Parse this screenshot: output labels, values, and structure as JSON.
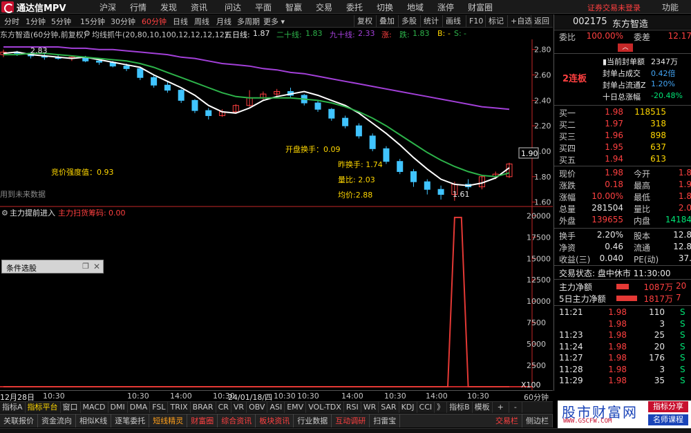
{
  "app": {
    "name": "通达信MPV",
    "security_warning": "证券交易未登录",
    "func_label": "功能"
  },
  "menu": [
    "沪深",
    "行情",
    "发现",
    "资讯",
    "问达",
    "平面",
    "智赢",
    "交易",
    "委托",
    "切换",
    "地域",
    "涨停",
    "财富圈"
  ],
  "periods": [
    {
      "label": "分时",
      "active": false
    },
    {
      "label": "1分钟",
      "active": false
    },
    {
      "label": "5分钟",
      "active": false
    },
    {
      "label": "15分钟",
      "active": false
    },
    {
      "label": "30分钟",
      "active": false
    },
    {
      "label": "60分钟",
      "active": true
    },
    {
      "label": "日线",
      "active": false
    },
    {
      "label": "周线",
      "active": false
    },
    {
      "label": "月线",
      "active": false
    },
    {
      "label": "多周期",
      "active": false
    },
    {
      "label": "更多",
      "active": false
    }
  ],
  "toolbar": [
    "复权",
    "叠加",
    "多股",
    "统计",
    "画线",
    "F10",
    "标记",
    "+自选",
    "返回"
  ],
  "indicator_line": {
    "stock": "东方智造(60分钟,前复权)",
    "indicator": "均线抓牛(20,80,10,100,12,12,12,12)",
    "ma5_label": "五日线:",
    "ma5_value": "1.87",
    "ma20_label": "二十线:",
    "ma20_value": "1.83",
    "ma90_label": "九十线:",
    "ma90_value": "2.33",
    "rise_label": "涨:",
    "rise_value": "",
    "fall_label": "跌:",
    "fall_value": "1.83",
    "b_label": "B:",
    "b_value": "-",
    "s_label": "S:",
    "s_value": "-"
  },
  "annotations": {
    "open_turnover": "开盘换手：0.09",
    "bid_strength": "竞价强度值：0.93",
    "prev_turnover": "昨换手: 1.74",
    "volume_ratio": "量比: 2.03",
    "avg_price": "均价:2.88",
    "hint": "用到未来数据",
    "low_mark": "1.61",
    "price_tag": "1.90",
    "high_mark_left": "2.83"
  },
  "sub_indicator": {
    "name": "主力提前进入",
    "line_label": "主力扫货筹码:",
    "line_value": "0.00"
  },
  "cond_panel": {
    "title": "条件选股"
  },
  "chart_data": [
    {
      "type": "line",
      "title": "",
      "y_ticks": [
        "2.80",
        "2.60",
        "2.40",
        "2.20",
        "2.00",
        "1.80",
        "1.60"
      ],
      "ylim": [
        1.56,
        2.88
      ],
      "x_labels": [
        "12月28日",
        "10:30",
        "10:30",
        "14:00",
        "10:30",
        "14:00",
        "10:30",
        "24/01/18/四",
        "10:30",
        "10:30",
        "14:00",
        "10:30",
        "14:00",
        "10:30"
      ],
      "series": [
        {
          "name": "五日线",
          "color": "#ffffff",
          "values": [
            2.77,
            2.78,
            2.76,
            2.75,
            2.74,
            2.73,
            2.74,
            2.72,
            2.7,
            2.68,
            2.66,
            2.6,
            2.55,
            2.5,
            2.44,
            2.36,
            2.31,
            2.3,
            2.34,
            2.4,
            2.43,
            2.45,
            2.47,
            2.44,
            2.4,
            2.36,
            2.3,
            2.22,
            2.14,
            2.05,
            1.95,
            1.86,
            1.78,
            1.74,
            1.73,
            1.75,
            1.79,
            1.87
          ]
        },
        {
          "name": "二十线",
          "color": "#2db34a",
          "values": [
            2.76,
            2.76,
            2.77,
            2.77,
            2.76,
            2.75,
            2.74,
            2.73,
            2.72,
            2.71,
            2.69,
            2.66,
            2.62,
            2.58,
            2.54,
            2.5,
            2.46,
            2.43,
            2.42,
            2.42,
            2.42,
            2.42,
            2.41,
            2.4,
            2.38,
            2.35,
            2.31,
            2.26,
            2.2,
            2.13,
            2.06,
            1.99,
            1.93,
            1.88,
            1.84,
            1.81,
            1.8,
            1.83
          ]
        },
        {
          "name": "九十线",
          "color": "#a340d9",
          "values": [
            2.82,
            2.82,
            2.82,
            2.82,
            2.82,
            2.81,
            2.81,
            2.8,
            2.8,
            2.79,
            2.78,
            2.77,
            2.76,
            2.74,
            2.73,
            2.71,
            2.69,
            2.68,
            2.67,
            2.65,
            2.64,
            2.62,
            2.61,
            2.59,
            2.57,
            2.55,
            2.53,
            2.51,
            2.49,
            2.47,
            2.45,
            2.43,
            2.41,
            2.39,
            2.37,
            2.35,
            2.34,
            2.33
          ]
        }
      ],
      "candles": [
        {
          "o": 2.76,
          "c": 2.78,
          "h": 2.8,
          "l": 2.74
        },
        {
          "o": 2.78,
          "c": 2.77,
          "h": 2.79,
          "l": 2.75
        },
        {
          "o": 2.77,
          "c": 2.75,
          "h": 2.78,
          "l": 2.73
        },
        {
          "o": 2.75,
          "c": 2.74,
          "h": 2.77,
          "l": 2.72
        },
        {
          "o": 2.74,
          "c": 2.73,
          "h": 2.76,
          "l": 2.72
        },
        {
          "o": 2.73,
          "c": 2.74,
          "h": 2.75,
          "l": 2.71
        },
        {
          "o": 2.74,
          "c": 2.71,
          "h": 2.75,
          "l": 2.7
        },
        {
          "o": 2.71,
          "c": 2.7,
          "h": 2.72,
          "l": 2.68
        },
        {
          "o": 2.7,
          "c": 2.67,
          "h": 2.71,
          "l": 2.66
        },
        {
          "o": 2.67,
          "c": 2.65,
          "h": 2.69,
          "l": 2.63
        },
        {
          "o": 2.65,
          "c": 2.58,
          "h": 2.66,
          "l": 2.56
        },
        {
          "o": 2.58,
          "c": 2.52,
          "h": 2.6,
          "l": 2.5
        },
        {
          "o": 2.52,
          "c": 2.48,
          "h": 2.55,
          "l": 2.46
        },
        {
          "o": 2.48,
          "c": 2.4,
          "h": 2.49,
          "l": 2.38
        },
        {
          "o": 2.4,
          "c": 2.32,
          "h": 2.41,
          "l": 2.3
        },
        {
          "o": 2.32,
          "c": 2.28,
          "h": 2.34,
          "l": 2.25
        },
        {
          "o": 2.28,
          "c": 2.31,
          "h": 2.33,
          "l": 2.27
        },
        {
          "o": 2.31,
          "c": 2.36,
          "h": 2.37,
          "l": 2.3
        },
        {
          "o": 2.36,
          "c": 2.42,
          "h": 2.48,
          "l": 2.35
        },
        {
          "o": 2.42,
          "c": 2.45,
          "h": 2.47,
          "l": 2.4
        },
        {
          "o": 2.45,
          "c": 2.47,
          "h": 2.49,
          "l": 2.43
        },
        {
          "o": 2.47,
          "c": 2.44,
          "h": 2.5,
          "l": 2.42
        },
        {
          "o": 2.44,
          "c": 2.38,
          "h": 2.45,
          "l": 2.36
        },
        {
          "o": 2.38,
          "c": 2.33,
          "h": 2.4,
          "l": 2.31
        },
        {
          "o": 2.33,
          "c": 2.26,
          "h": 2.34,
          "l": 2.24
        },
        {
          "o": 2.26,
          "c": 2.2,
          "h": 2.28,
          "l": 2.18
        },
        {
          "o": 2.2,
          "c": 2.12,
          "h": 2.22,
          "l": 2.1
        },
        {
          "o": 2.12,
          "c": 2.02,
          "h": 2.14,
          "l": 2.0
        },
        {
          "o": 2.02,
          "c": 1.92,
          "h": 2.04,
          "l": 1.9
        },
        {
          "o": 1.92,
          "c": 1.84,
          "h": 1.94,
          "l": 1.82
        },
        {
          "o": 1.84,
          "c": 1.76,
          "h": 1.86,
          "l": 1.72
        },
        {
          "o": 1.76,
          "c": 1.7,
          "h": 1.78,
          "l": 1.66
        },
        {
          "o": 1.7,
          "c": 1.66,
          "h": 1.73,
          "l": 1.62
        },
        {
          "o": 1.66,
          "c": 1.74,
          "h": 1.76,
          "l": 1.61
        },
        {
          "o": 1.74,
          "c": 1.72,
          "h": 1.78,
          "l": 1.7
        },
        {
          "o": 1.72,
          "c": 1.8,
          "h": 1.81,
          "l": 1.7
        },
        {
          "o": 1.8,
          "c": 1.82,
          "h": 1.84,
          "l": 1.78
        },
        {
          "o": 1.8,
          "c": 1.9,
          "h": 1.91,
          "l": 1.79
        }
      ]
    },
    {
      "type": "line",
      "title": "主力提前进入",
      "y_ticks": [
        "20000",
        "17500",
        "15000",
        "12500",
        "10000",
        "7500",
        "5000",
        "2500"
      ],
      "ylim": [
        0,
        21000
      ],
      "y_unit": "X100",
      "series": [
        {
          "name": "主力扫货筹码",
          "color": "#e53935",
          "values": [
            0,
            0,
            0,
            0,
            0,
            0,
            0,
            0,
            0,
            0,
            0,
            0,
            0,
            0,
            0,
            0,
            0,
            0,
            0,
            0,
            0,
            0,
            0,
            0,
            0,
            0,
            0,
            0,
            0,
            0,
            0,
            0,
            0,
            19800,
            0,
            0,
            0,
            0
          ]
        }
      ]
    }
  ],
  "time_axis": {
    "labels": [
      "12月28日",
      "10:30",
      "10:30",
      "14:00",
      "10:30",
      "24/01/18/四",
      "10:30",
      "10:30",
      "14:00",
      "10:30",
      "14:00",
      "10:30"
    ],
    "right_label": "60分钟"
  },
  "indicator_tabs": [
    "指标A",
    "指标平台",
    "窗口",
    "MACD",
    "DMI",
    "DMA",
    "FSL",
    "TRIX",
    "BRAR",
    "CR",
    "VR",
    "OBV",
    "ASI",
    "EMV",
    "VOL-TDX",
    "RSI",
    "WR",
    "SAR",
    "KDJ",
    "CCI",
    "》",
    "指标B",
    "模板"
  ],
  "indicator_tabs_right": [
    "+",
    "-"
  ],
  "bottom_bar": [
    {
      "label": "关联报价",
      "style": ""
    },
    {
      "label": "资金流向",
      "style": ""
    },
    {
      "label": "相似K线",
      "style": ""
    },
    {
      "label": "逐笔委托",
      "style": ""
    },
    {
      "label": "短线精灵",
      "style": "orange"
    },
    {
      "label": "财富圈",
      "style": "red"
    },
    {
      "label": "综合资讯",
      "style": "red"
    },
    {
      "label": "板块资讯",
      "style": "red"
    },
    {
      "label": "行业数据",
      "style": ""
    },
    {
      "label": "互动调研",
      "style": "red"
    },
    {
      "label": "扫雷宝",
      "style": ""
    },
    {
      "label": "交易栏",
      "style": "red"
    },
    {
      "label": "侧边栏",
      "style": ""
    }
  ],
  "quote": {
    "code": "002175",
    "name": "东方智造",
    "weibi_label": "委比",
    "weibi": "100.00%",
    "weicha_label": "委差",
    "weicha": "12.17",
    "limit_badge": "2连板",
    "seal_info": [
      {
        "label": "当前封单额",
        "value": "2347万"
      },
      {
        "label": "封单占成交",
        "value": "0.42倍"
      },
      {
        "label": "封单占流通Z",
        "value": "1.20%"
      },
      {
        "label": "十日总涨幅",
        "value": "-20.48%"
      }
    ],
    "bids": [
      {
        "label": "买一",
        "price": "1.98",
        "vol": "118515"
      },
      {
        "label": "买二",
        "price": "1.97",
        "vol": "318"
      },
      {
        "label": "买三",
        "price": "1.96",
        "vol": "898"
      },
      {
        "label": "买四",
        "price": "1.95",
        "vol": "637"
      },
      {
        "label": "买五",
        "price": "1.94",
        "vol": "613"
      }
    ],
    "stats": [
      {
        "l1": "现价",
        "v1": "1.98",
        "c1": "red",
        "l2": "今开",
        "v2": "1.8",
        "c2": "red"
      },
      {
        "l1": "涨跌",
        "v1": "0.18",
        "c1": "red",
        "l2": "最高",
        "v2": "1.9",
        "c2": "red"
      },
      {
        "l1": "涨幅",
        "v1": "10.00%",
        "c1": "red",
        "l2": "最低",
        "v2": "1.8",
        "c2": "red"
      },
      {
        "l1": "总量",
        "v1": "281504",
        "c1": "white",
        "l2": "量比",
        "v2": "2.0",
        "c2": "red"
      },
      {
        "l1": "外盘",
        "v1": "139655",
        "c1": "red",
        "l2": "内盘",
        "v2": "14184",
        "c2": "green"
      }
    ],
    "stats2": [
      {
        "l1": "换手",
        "v1": "2.20%",
        "l2": "股本",
        "v2": "12.8"
      },
      {
        "l1": "净资",
        "v1": "0.46",
        "l2": "流通",
        "v2": "12.8"
      },
      {
        "l1": "收益(三)",
        "v1": "0.040",
        "l2": "PE(动)",
        "v2": "37."
      }
    ],
    "trade_status": "交易状态: 盘中休市 11:30:00",
    "main_flow": [
      {
        "label": "主力净额",
        "value": "1087万",
        "pct": "20",
        "bar": 0.35
      },
      {
        "label": "5日主力净额",
        "value": "1817万",
        "pct": "7",
        "bar": 0.6
      }
    ],
    "ticks": [
      {
        "time": "11:21",
        "price": "1.98",
        "vol": "110",
        "flag": "S"
      },
      {
        "time": "",
        "price": "1.98",
        "vol": "3",
        "flag": "S"
      },
      {
        "time": "11:23",
        "price": "1.98",
        "vol": "25",
        "flag": "S"
      },
      {
        "time": "11:24",
        "price": "1.98",
        "vol": "20",
        "flag": "S"
      },
      {
        "time": "11:27",
        "price": "1.98",
        "vol": "176",
        "flag": "S"
      },
      {
        "time": "11:28",
        "price": "1.98",
        "vol": "3",
        "flag": "S"
      },
      {
        "time": "11:29",
        "price": "1.98",
        "vol": "35",
        "flag": "S"
      }
    ]
  },
  "watermark": {
    "title": "股市财富网",
    "url": "WWW.GSCFW.COM",
    "tag1": "指标分享",
    "tag2": "名师课程"
  }
}
